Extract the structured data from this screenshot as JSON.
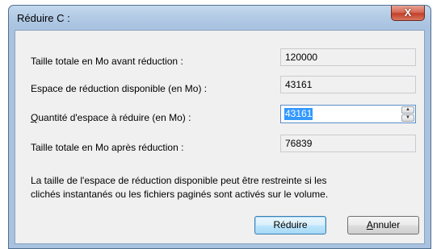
{
  "window": {
    "title": "Réduire C :",
    "close_label": "X"
  },
  "rows": [
    {
      "label": "Taille totale en Mo avant réduction :",
      "value": "120000"
    },
    {
      "label": "Espace de réduction disponible (en Mo) :",
      "value": "43161"
    },
    {
      "label_mnemonic": "Q",
      "label_rest": "uantité d'espace à réduire (en Mo) :",
      "value": "43161"
    },
    {
      "label": "Taille totale en Mo après réduction :",
      "value": "76839"
    }
  ],
  "note": {
    "line1": "La taille de l'espace de réduction disponible peut être restreinte si les",
    "line2": "clichés instantanés ou les fichiers paginés sont activés sur le volume."
  },
  "buttons": {
    "shrink_label": "Réduire",
    "cancel_mnemonic": "A",
    "cancel_rest": "nnuler"
  },
  "icons": {
    "spin_up": "spin-up-arrow",
    "spin_down": "spin-down-arrow"
  }
}
